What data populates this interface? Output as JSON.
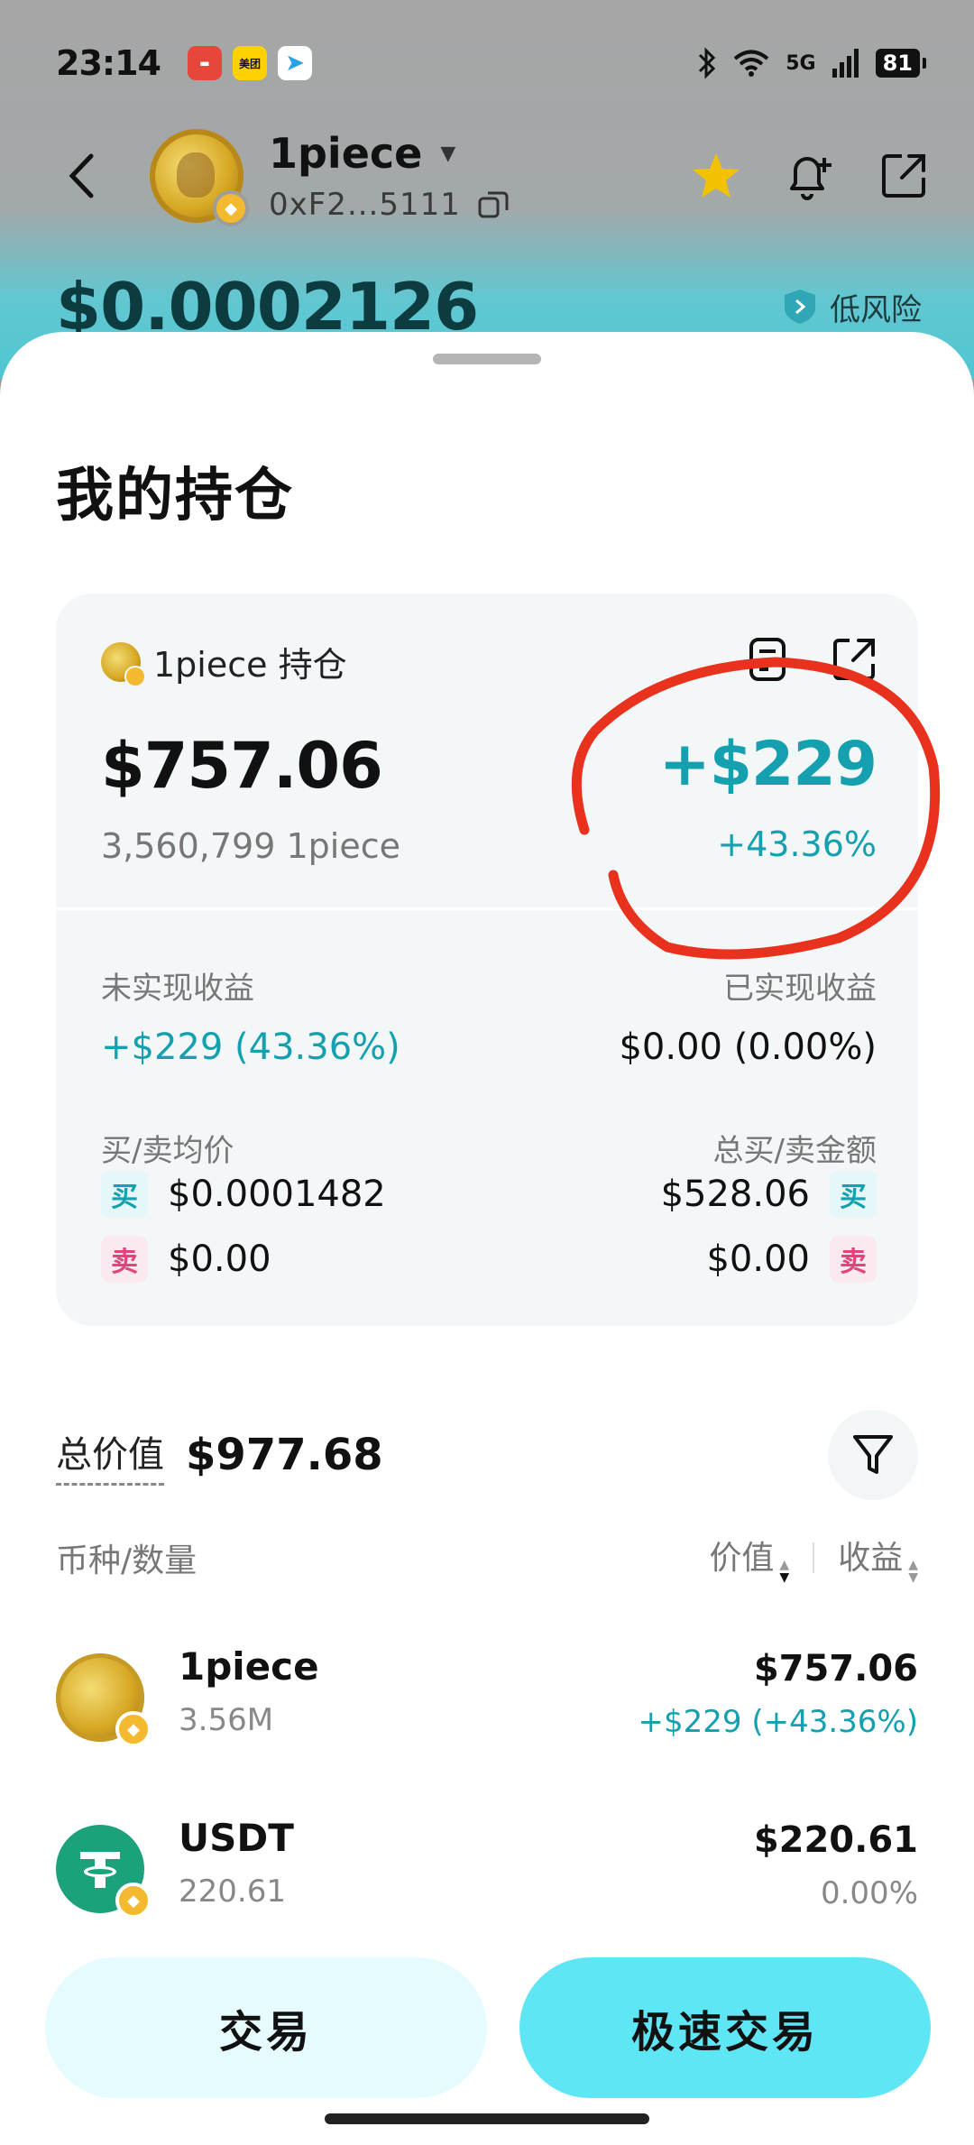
{
  "status_bar": {
    "time": "23:14",
    "apps": [
      "ticket-app",
      "美团",
      "telegram"
    ],
    "network": "5G",
    "battery": "81"
  },
  "header": {
    "token_name": "1piece",
    "address": "0xF2...5111",
    "price": "$0.0002126",
    "risk_label": "低风险",
    "star_color": "#f2c200"
  },
  "sheet": {
    "title": "我的持仓",
    "card": {
      "label": "1piece 持仓",
      "value": "$757.06",
      "quantity": "3,560,799 1piece",
      "pnl": "+$229",
      "pnl_pct": "+43.36%",
      "unrealized_label": "未实现收益",
      "unrealized_value": "+$229 (43.36%)",
      "realized_label": "已实现收益",
      "realized_value": "$0.00 (0.00%)",
      "avg_price_label": "买/卖均价",
      "buy_tag": "买",
      "sell_tag": "卖",
      "avg_buy": "$0.0001482",
      "avg_sell": "$0.00",
      "total_amount_label": "总买/卖金额",
      "total_buy": "$528.06",
      "total_sell": "$0.00"
    },
    "total_label": "总价值",
    "total_value": "$977.68",
    "list_header": {
      "asset": "币种/数量",
      "value": "价值",
      "pnl": "收益"
    },
    "assets": [
      {
        "name": "1piece",
        "qty": "3.56M",
        "value": "$757.06",
        "pnl": "+$229 (+43.36%)"
      },
      {
        "name": "USDT",
        "qty": "220.61",
        "value": "$220.61",
        "pnl": "0.00%"
      }
    ],
    "buttons": {
      "trade": "交易",
      "fast_trade": "极速交易"
    }
  },
  "colors": {
    "accent": "#14a0ae",
    "annotation": "#e8321e",
    "sell": "#e3437a"
  }
}
